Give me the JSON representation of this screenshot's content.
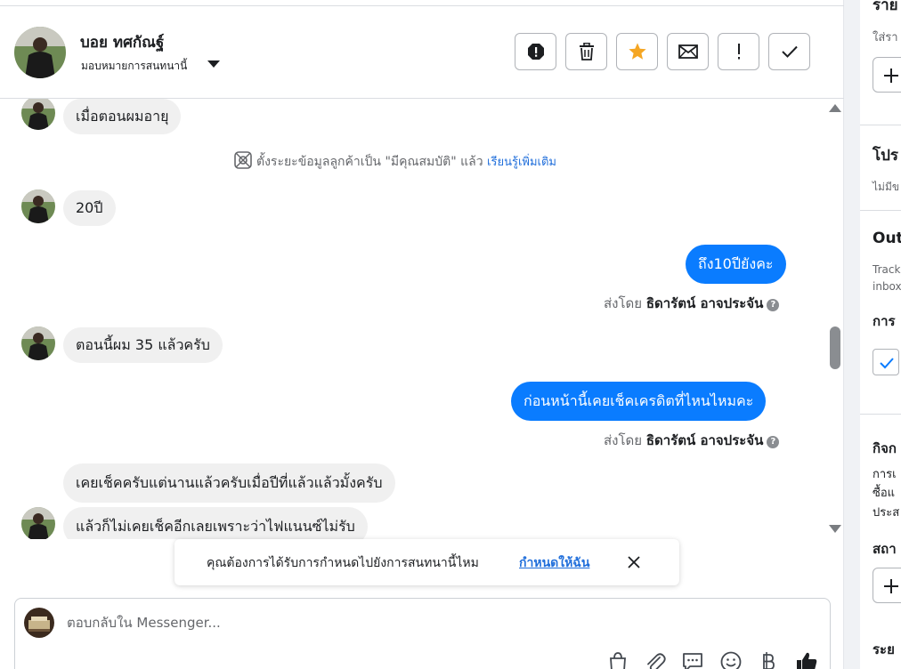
{
  "header": {
    "contact_name": "บอย ทศกัณฐ์",
    "assign_label": "มอบหมายการสนทนานี้",
    "actions": [
      {
        "name": "spam-button",
        "icon": "alert-octagon-icon"
      },
      {
        "name": "delete-button",
        "icon": "trash-icon"
      },
      {
        "name": "star-button",
        "icon": "star-icon"
      },
      {
        "name": "mark-unread-button",
        "icon": "envelope-icon"
      },
      {
        "name": "follow-up-button",
        "icon": "exclamation-icon"
      },
      {
        "name": "mark-done-button",
        "icon": "check-icon"
      }
    ]
  },
  "messages": {
    "m1": "เมื่อตอนผมอายุ",
    "system_text": "ตั้งระยะข้อมูลลูกค้าเป็น \"มีคุณสมบัติ\" แล้ว",
    "system_link": "เรียนรู้เพิ่มเติม",
    "m2": "20ปี",
    "m3": "ถึง10ปียังคะ",
    "sent_by_prefix": "ส่งโดย",
    "sent_by_name": "ธิดารัตน์ อาจประจัน",
    "m4": "ตอนนี้ผม 35 แล้วครับ",
    "m5": "ก่อนหน้านี้เคยเช็คเครดิตที่ไหนไหมคะ",
    "m6": "เคยเช็คครับแต่นานแล้วครับเมื่อปีที่แล้วแล้วมั้งครับ",
    "m7": "แล้วก็ไม่เคยเช็คอีกเลยเพราะว่าไฟแนนซ์ไม่รับ"
  },
  "toast": {
    "text": "คุณต้องการได้รับการกำหนดไปยังการสนทนานี้ไหม",
    "link": "กำหนดให้ฉัน"
  },
  "composer": {
    "placeholder": "ตอบกลับใน Messenger...",
    "icons": [
      "bag-icon",
      "paperclip-icon",
      "chat-icon",
      "emoji-icon",
      "baht-icon",
      "thumbs-up-icon"
    ]
  },
  "sidebar": {
    "t1": "ราย",
    "t2": "ใส่รา",
    "t3": "โปร",
    "t4": "ไม่มีข",
    "t5": "Out",
    "t6": "Track",
    "t7": "inbox",
    "t8": "การ",
    "t9": "กิจก",
    "t10": "การเ",
    "t11": "ซื้อแ",
    "t12": "ประส",
    "t13": "สถา",
    "t14": "ระย"
  },
  "colors": {
    "accent": "#0a7cff",
    "link": "#216fdb",
    "star": "#f5a623"
  }
}
